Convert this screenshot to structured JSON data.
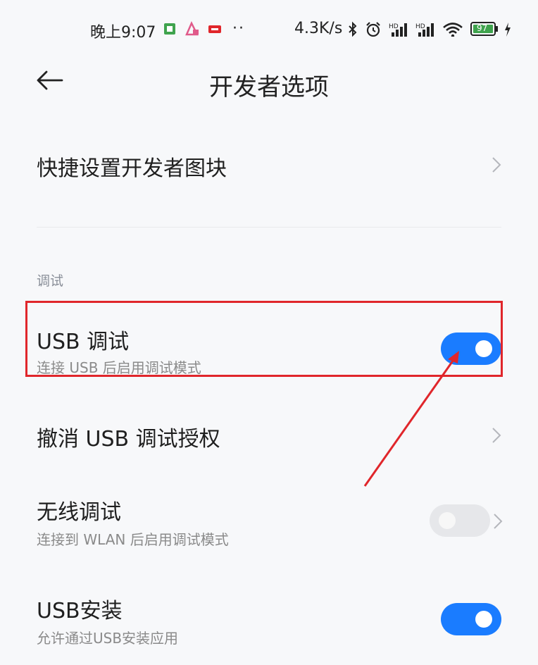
{
  "status_bar": {
    "time": "晚上9:07",
    "dots": "··",
    "network_speed": "4.3K/s",
    "battery_level": "97",
    "icons": [
      "notification-app-icon",
      "notification-app-icon-2",
      "notification-app-icon-3",
      "bluetooth-icon",
      "alarm-icon",
      "signal-icon",
      "signal-icon-2",
      "wifi-icon",
      "battery-icon",
      "charging-icon"
    ]
  },
  "header": {
    "title": "开发者选项",
    "back_icon": "back-arrow-icon"
  },
  "rows": {
    "quick_tiles": {
      "title": "快捷设置开发者图块"
    },
    "section_debug": "调试",
    "usb_debug": {
      "title": "USB 调试",
      "subtitle": "连接 USB 后启用调试模式",
      "enabled": true
    },
    "revoke_usb": {
      "title": "撤消 USB 调试授权"
    },
    "wireless_debug": {
      "title": "无线调试",
      "subtitle": "连接到 WLAN 后启用调试模式",
      "enabled": false
    },
    "usb_install": {
      "title": "USB安装",
      "subtitle": "允许通过USB安装应用",
      "enabled": true
    }
  },
  "colors": {
    "accent": "#1a7cff",
    "highlight": "#e0262b",
    "background": "#f7f8fa"
  }
}
